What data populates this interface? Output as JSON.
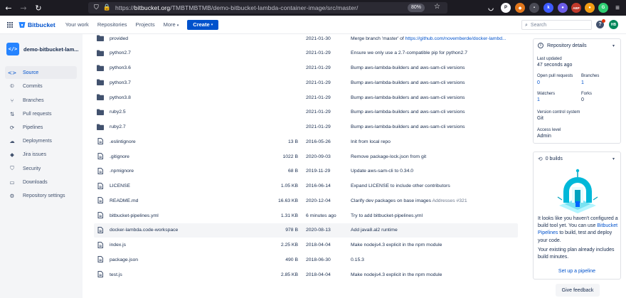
{
  "browser": {
    "url_prefix": "https://",
    "url_host": "bitbucket.org",
    "url_path": "/TMBTMBTMB/demo-bitbucket-lambda-container-image/src/master/",
    "zoom": "80%"
  },
  "header": {
    "product": "Bitbucket",
    "nav": [
      "Your work",
      "Repositories",
      "Projects",
      "More"
    ],
    "create_label": "Create",
    "search_placeholder": "Search",
    "avatar_initials": "HB"
  },
  "sidebar": {
    "repo_name": "demo-bitbucket-lam...",
    "items": [
      {
        "label": "Source",
        "icon": "code-icon",
        "active": true
      },
      {
        "label": "Commits",
        "icon": "commit-icon"
      },
      {
        "label": "Branches",
        "icon": "branch-icon"
      },
      {
        "label": "Pull requests",
        "icon": "pull-request-icon"
      },
      {
        "label": "Pipelines",
        "icon": "pipelines-icon"
      },
      {
        "label": "Deployments",
        "icon": "deployments-icon"
      },
      {
        "label": "Jira issues",
        "icon": "jira-icon"
      },
      {
        "label": "Security",
        "icon": "shield-icon"
      },
      {
        "label": "Downloads",
        "icon": "download-icon"
      },
      {
        "label": "Repository settings",
        "icon": "gear-icon"
      }
    ]
  },
  "files": [
    {
      "name": "provided",
      "type": "folder",
      "size": "",
      "date": "2021-01-30",
      "message": "Merge branch 'master' of ",
      "link": "https://github.com/novemberde/docker-lambd..."
    },
    {
      "name": "python2.7",
      "type": "folder",
      "size": "",
      "date": "2021-01-29",
      "message": "Ensure we only use a 2.7-compatible pip for python2.7"
    },
    {
      "name": "python3.6",
      "type": "folder",
      "size": "",
      "date": "2021-01-29",
      "message": "Bump aws-lambda-builders and aws-sam-cli versions"
    },
    {
      "name": "python3.7",
      "type": "folder",
      "size": "",
      "date": "2021-01-29",
      "message": "Bump aws-lambda-builders and aws-sam-cli versions"
    },
    {
      "name": "python3.8",
      "type": "folder",
      "size": "",
      "date": "2021-01-29",
      "message": "Bump aws-lambda-builders and aws-sam-cli versions"
    },
    {
      "name": "ruby2.5",
      "type": "folder",
      "size": "",
      "date": "2021-01-29",
      "message": "Bump aws-lambda-builders and aws-sam-cli versions"
    },
    {
      "name": "ruby2.7",
      "type": "folder",
      "size": "",
      "date": "2021-01-29",
      "message": "Bump aws-lambda-builders and aws-sam-cli versions"
    },
    {
      "name": ".eslintignore",
      "type": "file",
      "size": "13 B",
      "date": "2016-05-26",
      "message": "Init from local repo"
    },
    {
      "name": ".gitignore",
      "type": "file",
      "size": "1022 B",
      "date": "2020-09-03",
      "message": "Remove package-lock.json from git"
    },
    {
      "name": ".npmignore",
      "type": "file",
      "size": "68 B",
      "date": "2019-11-29",
      "message": "Update aws-sam-cli to 0.34.0"
    },
    {
      "name": "LICENSE",
      "type": "file",
      "size": "1.05 KB",
      "date": "2016-06-14",
      "message": "Expand LICENSE to include other contributors"
    },
    {
      "name": "README.md",
      "type": "file",
      "size": "16.63 KB",
      "date": "2020-12-04",
      "message": "Clarify dev packages on base images ",
      "ref": "Addresses #321"
    },
    {
      "name": "bitbucket-pipelines.yml",
      "type": "file",
      "size": "1.31 KB",
      "date": "6 minutes ago",
      "message": "Try to add bitbucket-pipelines.yml"
    },
    {
      "name": "docker-lambda.code-workspace",
      "type": "file",
      "size": "978 B",
      "date": "2020-08-13",
      "message": "Add java8.al2 runtime",
      "highlight": true
    },
    {
      "name": "index.js",
      "type": "file",
      "size": "2.25 KB",
      "date": "2018-04-04",
      "message": "Make nodejs4.3 explicit in the npm module"
    },
    {
      "name": "package.json",
      "type": "file",
      "size": "490 B",
      "date": "2018-06-30",
      "message": "0.15.3"
    },
    {
      "name": "test.js",
      "type": "file",
      "size": "2.85 KB",
      "date": "2018-04-04",
      "message": "Make nodejs4.3 explicit in the npm module"
    }
  ],
  "details": {
    "title": "Repository details",
    "last_updated_label": "Last updated",
    "last_updated": "47 seconds ago",
    "open_prs_label": "Open pull requests",
    "open_prs": "0",
    "branches_label": "Branches",
    "branches": "1",
    "watchers_label": "Watchers",
    "watchers": "1",
    "forks_label": "Forks",
    "forks": "0",
    "vcs_label": "Version control system",
    "vcs": "Git",
    "access_label": "Access level",
    "access": "Admin"
  },
  "builds": {
    "title": "0 builds",
    "text_1": "It looks like you haven't configured a build tool yet. You can use ",
    "link": "Bitbucket Pipelines",
    "text_2": " to build, test and deploy your code.",
    "text_3": "Your existing plan already includes build minutes.",
    "setup_link": "Set up a pipeline"
  },
  "feedback_label": "Give feedback",
  "colors": {
    "brand": "#0052cc",
    "sidebar_bg": "#f4f5f7",
    "browser_bg": "#1c1b22"
  }
}
